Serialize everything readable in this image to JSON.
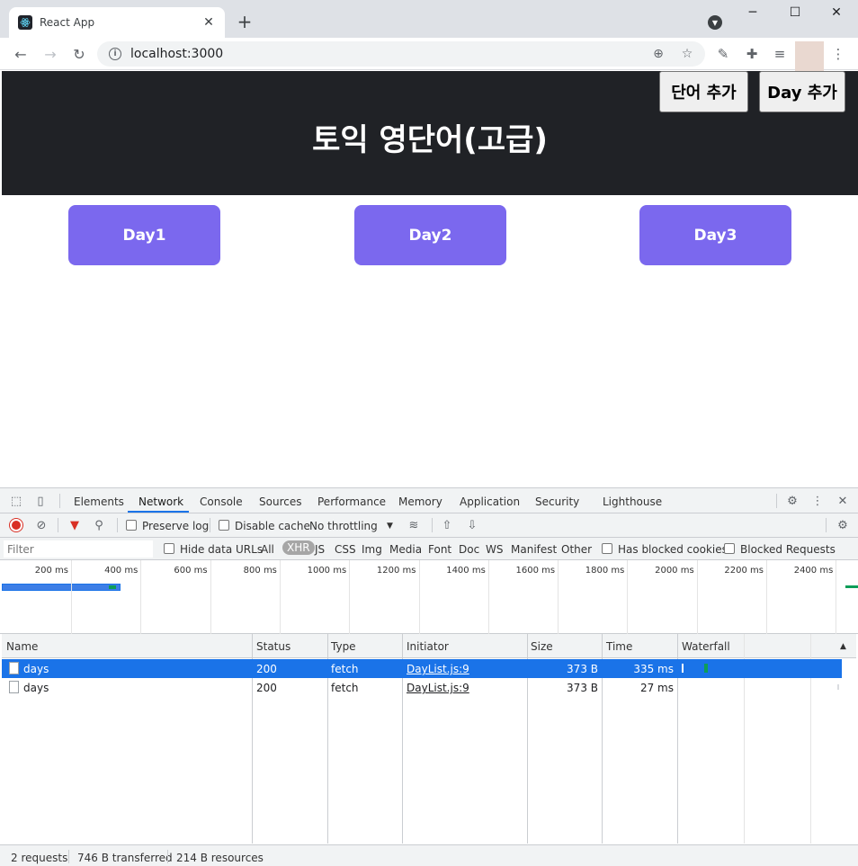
{
  "browser": {
    "tab_title": "React App",
    "tab_close": "✕",
    "new_tab": "+",
    "url": "localhost:3000",
    "window": {
      "minimize": "─",
      "maximize": "☐",
      "close": "✕"
    }
  },
  "app": {
    "title": "토익 영단어(고급)",
    "add_word_button": "단어 추가",
    "add_day_button": "Day 추가",
    "days": [
      "Day1",
      "Day2",
      "Day3"
    ]
  },
  "devtools": {
    "tabs": [
      "Elements",
      "Network",
      "Console",
      "Sources",
      "Performance",
      "Memory",
      "Application",
      "Security",
      "Lighthouse"
    ],
    "active_tab": "Network",
    "preserve_log": "Preserve log",
    "disable_cache": "Disable cache",
    "throttling": "No throttling",
    "filter_placeholder": "Filter",
    "hide_data_urls": "Hide data URLs",
    "types": [
      "All",
      "XHR",
      "JS",
      "CSS",
      "Img",
      "Media",
      "Font",
      "Doc",
      "WS",
      "Manifest",
      "Other"
    ],
    "selected_type": "XHR",
    "has_blocked_cookies": "Has blocked cookies",
    "blocked_requests": "Blocked Requests",
    "timeline_ticks": [
      "200 ms",
      "400 ms",
      "600 ms",
      "800 ms",
      "1000 ms",
      "1200 ms",
      "1400 ms",
      "1600 ms",
      "1800 ms",
      "2000 ms",
      "2200 ms",
      "2400 ms"
    ],
    "columns": [
      "Name",
      "Status",
      "Type",
      "Initiator",
      "Size",
      "Time",
      "Waterfall"
    ],
    "requests": [
      {
        "name": "days",
        "status": "200",
        "type": "fetch",
        "initiator": "DayList.js:9",
        "size": "373 B",
        "time": "335 ms"
      },
      {
        "name": "days",
        "status": "200",
        "type": "fetch",
        "initiator": "DayList.js:9",
        "size": "373 B",
        "time": "27 ms"
      }
    ],
    "status": {
      "requests": "2 requests",
      "transferred": "746 B transferred",
      "resources": "214 B resources"
    }
  }
}
